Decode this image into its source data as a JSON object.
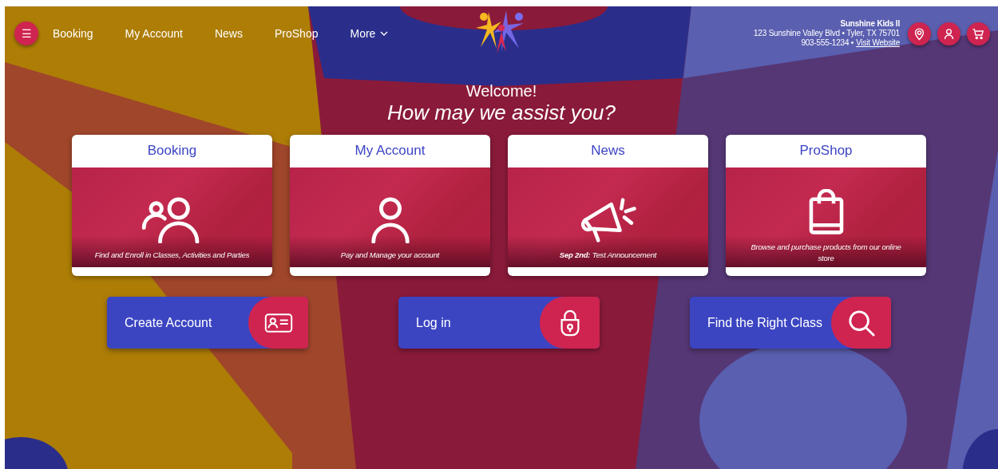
{
  "nav": {
    "menu_button": {
      "label": "☰"
    },
    "links": [
      {
        "label": "Booking"
      },
      {
        "label": "My Account"
      },
      {
        "label": "News"
      },
      {
        "label": "ProShop"
      },
      {
        "label": "More",
        "dropdown": true
      }
    ]
  },
  "business": {
    "name": "Sunshine Kids II",
    "address": "123 Sunshine Valley Blvd • Tyler, TX 75701",
    "phone": "903-555-1234 •",
    "website_link": "Visit Website"
  },
  "header_buttons": [
    {
      "kind": "location"
    },
    {
      "kind": "account"
    },
    {
      "kind": "cart"
    }
  ],
  "welcome": {
    "title": "Welcome!",
    "subtitle": "How may we assist you?"
  },
  "cards": [
    {
      "kind": "people",
      "title": "Booking",
      "description": "Find and Enroll in Classes, Activities and Parties"
    },
    {
      "kind": "person",
      "title": "My Account",
      "description": "Pay and Manage your account"
    },
    {
      "kind": "megaphone",
      "title": "News",
      "description": "**Sep 2nd:**  Test Announcement"
    },
    {
      "kind": "bag",
      "title": "ProShop",
      "description": "Browse and purchase products from our online store"
    }
  ],
  "actions": [
    {
      "kind": "id-card",
      "label": "Create Account"
    },
    {
      "kind": "lock",
      "label": "Log in"
    },
    {
      "kind": "search",
      "label": "Find the Right Class"
    }
  ]
}
